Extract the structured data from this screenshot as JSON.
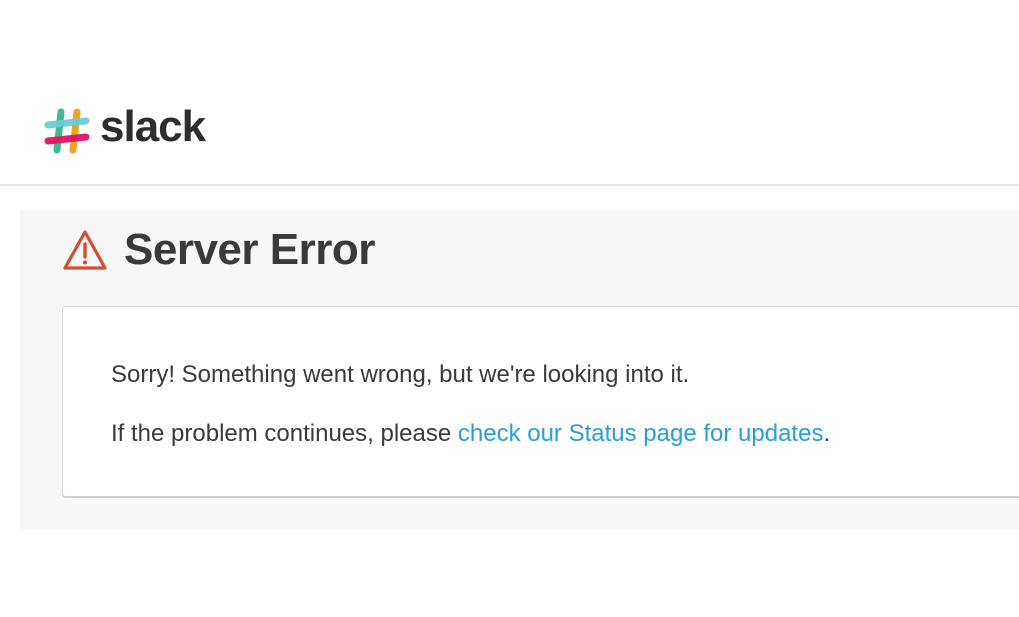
{
  "header": {
    "logo": {
      "icon": "slack-hash-logo-icon",
      "wordmark": "slack",
      "colors": {
        "teal": "#3eb991",
        "yellow": "#e9a820",
        "red": "#e01563",
        "blue": "#6ecadc"
      }
    }
  },
  "error": {
    "icon": "warning-triangle-icon",
    "icon_color": "#d14f2f",
    "title": "Server Error",
    "message_line1": "Sorry! Something went wrong, but we're looking into it.",
    "message_line2_prefix": "If the problem continues, please ",
    "status_link_label": "check our Status page for updates",
    "message_line2_suffix": ".",
    "link_color": "#2a9fd6"
  }
}
